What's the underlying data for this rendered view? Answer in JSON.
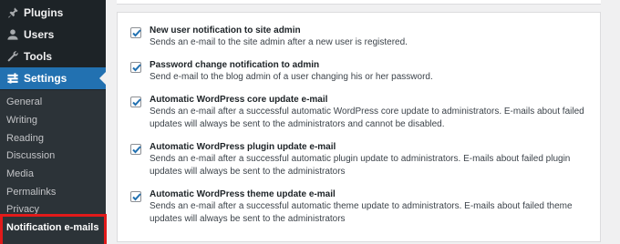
{
  "sidebar": {
    "menu": [
      {
        "label": "Plugins",
        "icon": "plugin-icon"
      },
      {
        "label": "Users",
        "icon": "users-icon"
      },
      {
        "label": "Tools",
        "icon": "wrench-icon"
      },
      {
        "label": "Settings",
        "icon": "settings-icon"
      }
    ],
    "submenu": [
      {
        "label": "General"
      },
      {
        "label": "Writing"
      },
      {
        "label": "Reading"
      },
      {
        "label": "Discussion"
      },
      {
        "label": "Media"
      },
      {
        "label": "Permalinks"
      },
      {
        "label": "Privacy"
      },
      {
        "label": "Notification e-mails"
      }
    ]
  },
  "options": [
    {
      "title": "New user notification to site admin",
      "description": "Sends an e-mail to the site admin after a new user is registered.",
      "checked": true
    },
    {
      "title": "Password change notification to admin",
      "description": "Send e-mail to the blog admin of a user changing his or her password.",
      "checked": true
    },
    {
      "title": "Automatic WordPress core update e-mail",
      "description": "Sends an e-mail after a successful automatic WordPress core update to administrators. E-mails about failed updates will always be sent to the administrators and cannot be disabled.",
      "checked": true
    },
    {
      "title": "Automatic WordPress plugin update e-mail",
      "description": "Sends an e-mail after a successful automatic plugin update to administrators. E-mails about failed plugin updates will always be sent to the administrators",
      "checked": true
    },
    {
      "title": "Automatic WordPress theme update e-mail",
      "description": "Sends an e-mail after a successful automatic theme update to administrators. E-mails about failed theme updates will always be sent to the administrators",
      "checked": true
    }
  ],
  "colors": {
    "sidebar_bg": "#1d2327",
    "submenu_bg": "#2c3338",
    "accent": "#2271b1",
    "highlight": "#e21a1a"
  }
}
